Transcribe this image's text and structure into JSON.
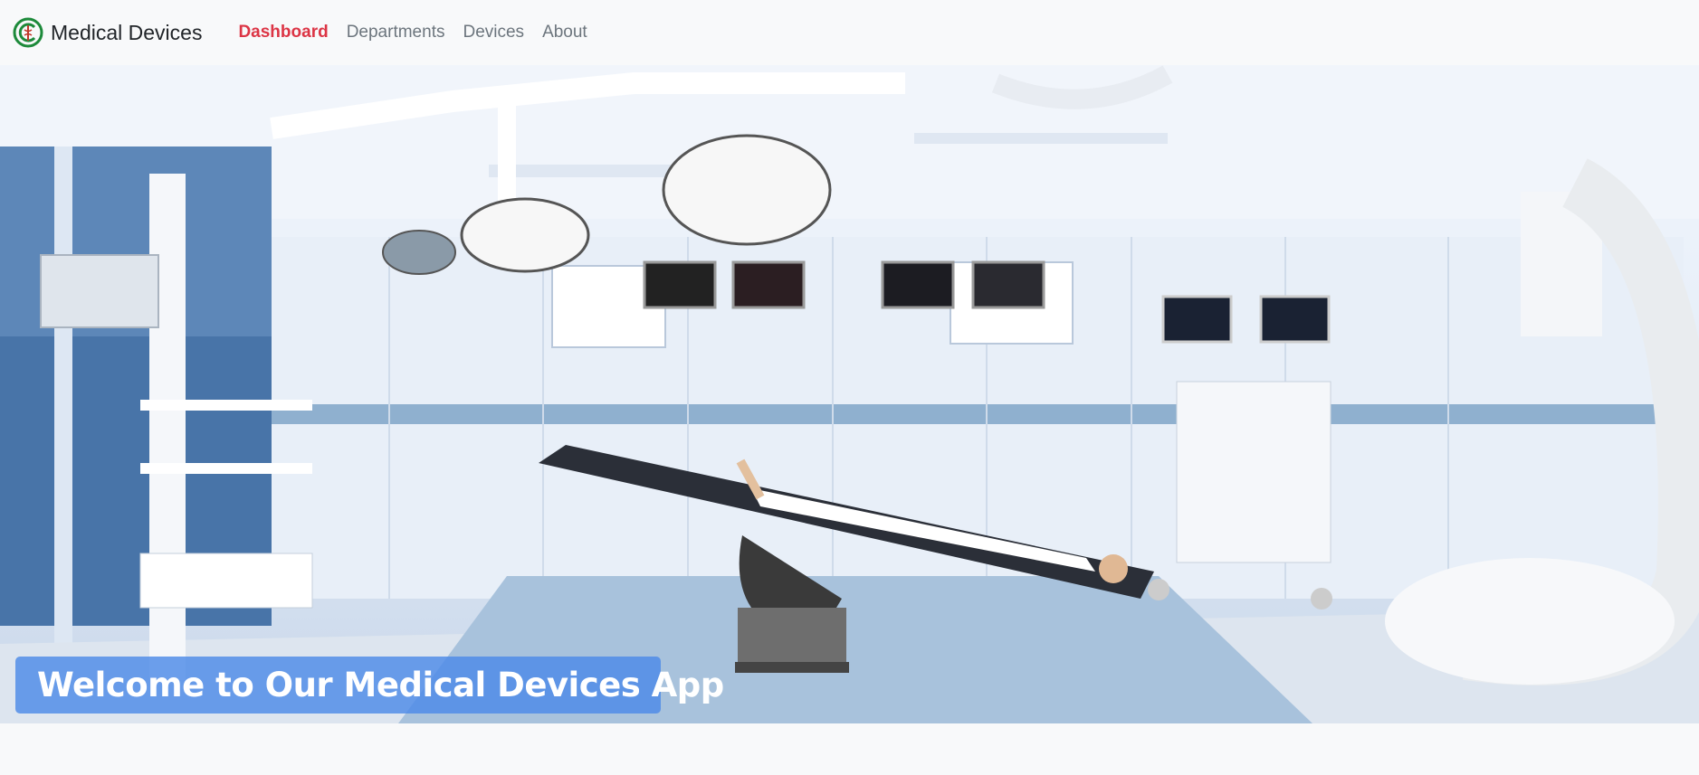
{
  "brand": {
    "name": "Medical Devices"
  },
  "nav": {
    "items": [
      {
        "label": "Dashboard",
        "active": true
      },
      {
        "label": "Departments",
        "active": false
      },
      {
        "label": "Devices",
        "active": false
      },
      {
        "label": "About",
        "active": false
      }
    ]
  },
  "hero": {
    "headline": "Welcome to Our Medical Devices App"
  },
  "colors": {
    "active_link": "#dc3545",
    "link": "#6c757d",
    "banner": "#4d8ae8"
  },
  "icons": {
    "brand_logo": "caduceus-logo-icon"
  }
}
